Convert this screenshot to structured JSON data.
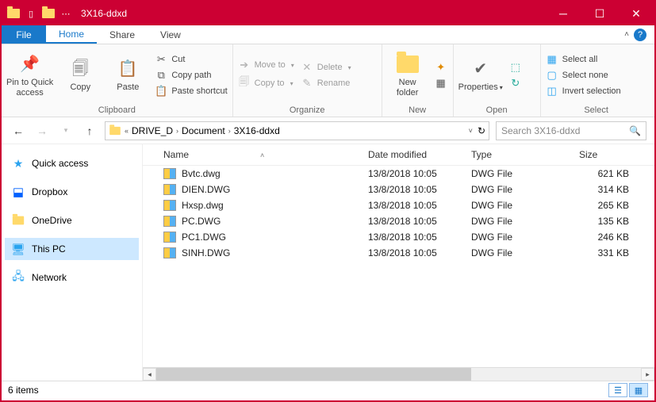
{
  "window": {
    "title": "3X16-ddxd"
  },
  "menutabs": {
    "file": "File",
    "home": "Home",
    "share": "Share",
    "view": "View"
  },
  "ribbon": {
    "pin": "Pin to Quick\naccess",
    "copy": "Copy",
    "paste": "Paste",
    "cut": "Cut",
    "copypath": "Copy path",
    "pasteshortcut": "Paste shortcut",
    "clipboard": "Clipboard",
    "moveto": "Move to",
    "copyto": "Copy to",
    "delete": "Delete",
    "rename": "Rename",
    "organize": "Organize",
    "newfolder": "New\nfolder",
    "new": "New",
    "properties": "Properties",
    "open": "Open",
    "selectall": "Select all",
    "selectnone": "Select none",
    "invert": "Invert selection",
    "select": "Select"
  },
  "breadcrumb": {
    "seg1": "DRIVE_D",
    "seg2": "Document",
    "seg3": "3X16-ddxd"
  },
  "search": {
    "placeholder": "Search 3X16-ddxd"
  },
  "columns": {
    "name": "Name",
    "date": "Date modified",
    "type": "Type",
    "size": "Size"
  },
  "nav": {
    "quick": "Quick access",
    "dropbox": "Dropbox",
    "onedrive": "OneDrive",
    "thispc": "This PC",
    "network": "Network"
  },
  "files": [
    {
      "name": "Bvtc.dwg",
      "date": "13/8/2018 10:05",
      "type": "DWG File",
      "size": "621 KB"
    },
    {
      "name": "DIEN.DWG",
      "date": "13/8/2018 10:05",
      "type": "DWG File",
      "size": "314 KB"
    },
    {
      "name": "Hxsp.dwg",
      "date": "13/8/2018 10:05",
      "type": "DWG File",
      "size": "265 KB"
    },
    {
      "name": "PC.DWG",
      "date": "13/8/2018 10:05",
      "type": "DWG File",
      "size": "135 KB"
    },
    {
      "name": "PC1.DWG",
      "date": "13/8/2018 10:05",
      "type": "DWG File",
      "size": "246 KB"
    },
    {
      "name": "SINH.DWG",
      "date": "13/8/2018 10:05",
      "type": "DWG File",
      "size": "331 KB"
    }
  ],
  "status": {
    "count": "6 items"
  }
}
